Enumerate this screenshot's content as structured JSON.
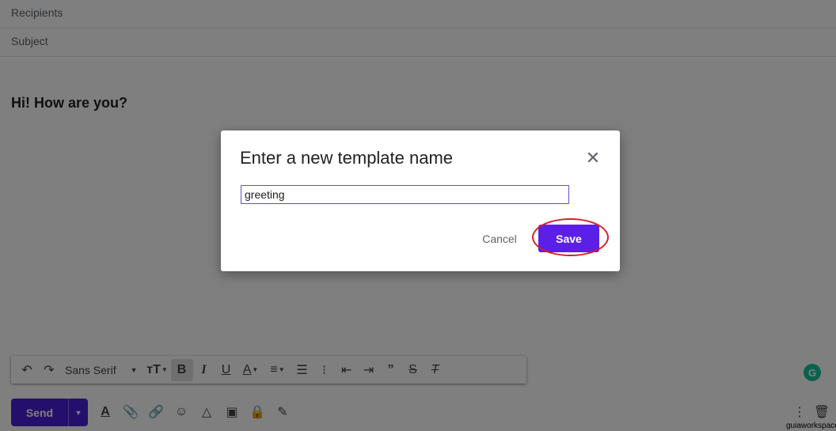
{
  "compose": {
    "recipients_label": "Recipients",
    "subject_label": "Subject",
    "body_text": "Hi! How are you?"
  },
  "toolbar": {
    "undo_icon": "undo-icon",
    "redo_icon": "redo-icon",
    "font_name": "Sans Serif",
    "size_icon": "text-size-icon",
    "bold_icon": "bold-icon",
    "italic_icon": "italic-icon",
    "underline_icon": "underline-icon",
    "text_color_icon": "text-color-icon",
    "align_icon": "align-icon",
    "numbered_list_icon": "numbered-list-icon",
    "bulleted_list_icon": "bulleted-list-icon",
    "indent_less_icon": "indent-less-icon",
    "indent_more_icon": "indent-more-icon",
    "quote_icon": "quote-icon",
    "strikethrough_icon": "strikethrough-icon",
    "clear_format_icon": "clear-formatting-icon"
  },
  "bottombar": {
    "send_label": "Send",
    "icons": [
      "formatting-options-icon",
      "attach-icon",
      "link-icon",
      "emoji-icon",
      "drive-icon",
      "photo-icon",
      "confidential-mode-icon",
      "signature-icon"
    ],
    "more_icon": "more-options-icon",
    "delete_icon": "trash-icon"
  },
  "dialog": {
    "title": "Enter a new template name",
    "input_value": "greeting",
    "cancel_label": "Cancel",
    "save_label": "Save"
  },
  "grammarly_letter": "G",
  "watermark": "guiaworkspace",
  "colors": {
    "accent": "#5b1fe8",
    "highlight": "#d61f26",
    "overlay": "rgba(0,0,0,0.5)"
  }
}
